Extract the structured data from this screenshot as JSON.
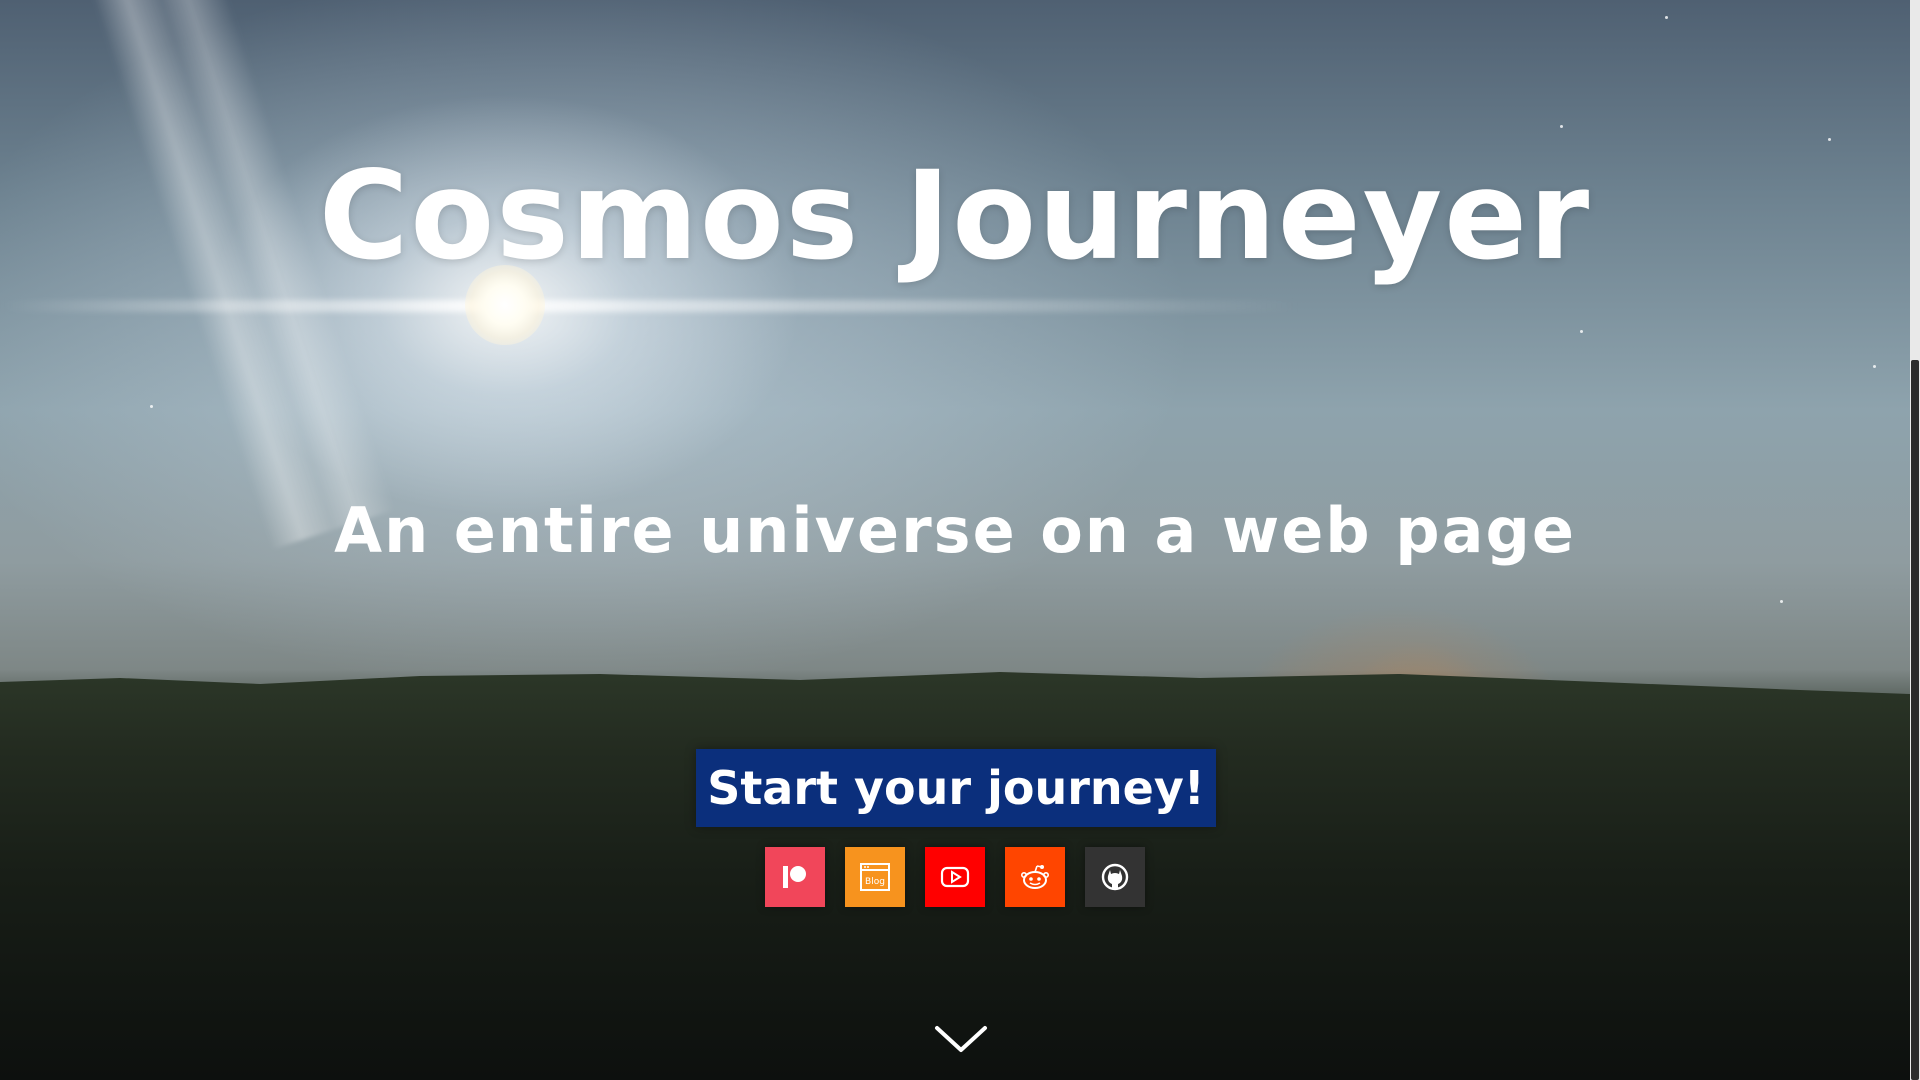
{
  "hero": {
    "title": "Cosmos Journeyer",
    "subtitle": "An entire universe on a web page",
    "cta_label": "Start your journey!"
  },
  "socials": [
    {
      "name": "patreon",
      "icon": "patreon-icon",
      "color": "#f1465a"
    },
    {
      "name": "blog",
      "icon": "blog-icon",
      "label": "Blog",
      "color": "#f7931e"
    },
    {
      "name": "youtube",
      "icon": "youtube-icon",
      "color": "#ff0000"
    },
    {
      "name": "reddit",
      "icon": "reddit-icon",
      "color": "#ff4500"
    },
    {
      "name": "github",
      "icon": "github-icon",
      "color": "#333333"
    }
  ],
  "scroll_indicator": {
    "icon": "chevron-down-icon"
  },
  "colors": {
    "cta_background": "#0b2f7c",
    "text": "#ffffff"
  }
}
